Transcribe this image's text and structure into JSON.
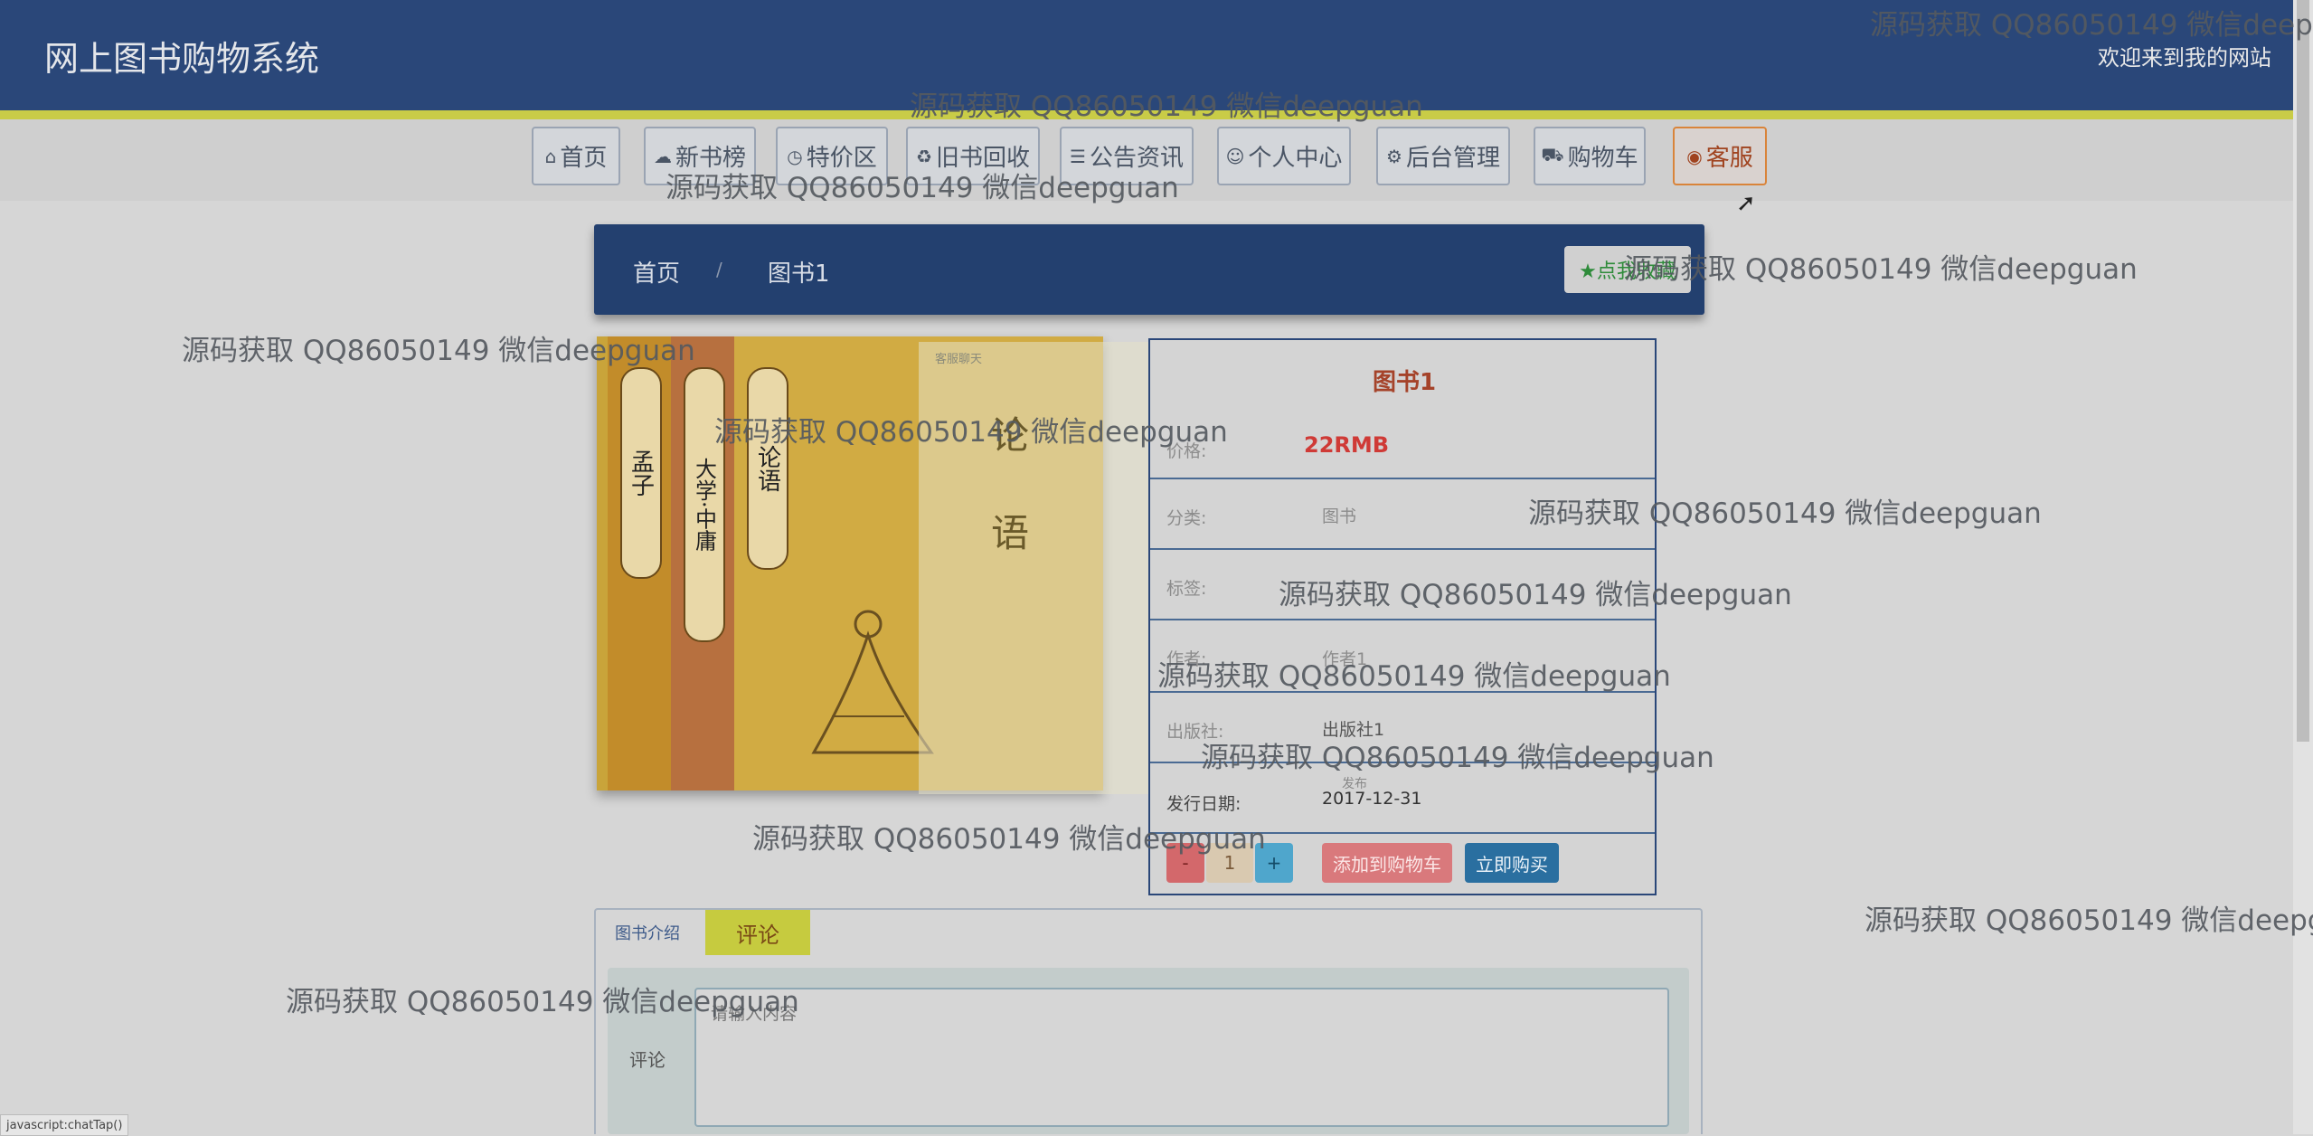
{
  "header": {
    "site_title": "网上图书购物系统",
    "welcome": "欢迎来到我的网站"
  },
  "nav": {
    "items": [
      {
        "icon": "home-icon",
        "glyph": "⌂",
        "label": "首页"
      },
      {
        "icon": "chat-icon",
        "glyph": "☁",
        "label": "新书榜"
      },
      {
        "icon": "clock-icon",
        "glyph": "◷",
        "label": "特价区"
      },
      {
        "icon": "recycle-icon",
        "glyph": "♻",
        "label": "旧书回收"
      },
      {
        "icon": "news-icon",
        "glyph": "☰",
        "label": "公告资讯"
      },
      {
        "icon": "user-icon",
        "glyph": "☺",
        "label": "个人中心"
      },
      {
        "icon": "link-icon",
        "glyph": "⚙",
        "label": "后台管理"
      },
      {
        "icon": "cart-icon",
        "glyph": "⛟",
        "label": "购物车"
      },
      {
        "icon": "service-icon",
        "glyph": "◉",
        "label": "客服"
      }
    ]
  },
  "breadcrumb": {
    "home": "首页",
    "separator": "/",
    "current": "图书1",
    "collect_label": "★点我收藏"
  },
  "cover": {
    "titles": [
      "孟子",
      "大学·中庸",
      "论语"
    ],
    "chat_title": "客服聊天",
    "chat_close": "×",
    "chat_big_1": "论",
    "chat_big_2": "语"
  },
  "book": {
    "name": "图书1",
    "price_label": "价格:",
    "price": "22RMB",
    "category_label": "分类:",
    "category": "图书",
    "tag_label": "标签:",
    "author_label": "作者:",
    "author": "作者1",
    "publisher_label": "出版社:",
    "publisher": "出版社1",
    "date_label": "发行日期:",
    "date": "2017-12-31",
    "publish_text": "发布",
    "quantity": "1",
    "minus": "-",
    "plus": "+",
    "add_to_cart": "添加到购物车",
    "buy_now": "立即购买"
  },
  "tabs": {
    "intro": "图书介绍",
    "comment": "评论",
    "comment_label": "评论",
    "comment_placeholder": "请输入内容"
  },
  "status_bar": "javascript:chatTap()",
  "watermark": "源码获取 QQ86050149 微信deepguan",
  "colors": {
    "header_bg": "#2a4779",
    "accent_stripe": "#c9cc47",
    "price": "#cf3a36",
    "add_button": "#d9797c",
    "buy_button": "#2a6fa0",
    "plus_button": "#4fa6cc",
    "minus_button": "#d3686b"
  }
}
